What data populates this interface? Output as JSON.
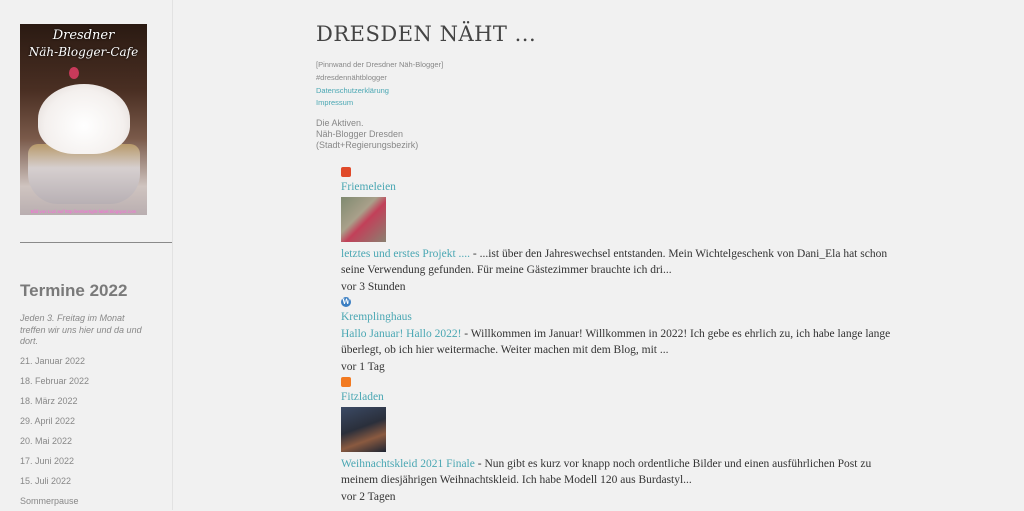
{
  "sidebar": {
    "logo": {
      "line1": "Dresdner",
      "line2": "Näh-Blogger-Cafe",
      "credit": "Bild von Luzi auf http://embertight-label.blogspot.com"
    },
    "termine_title": "Termine 2022",
    "termine_description": "Jeden 3. Freitag im Monat treffen wir uns hier und da und dort.",
    "dates": [
      "21. Januar 2022",
      "18. Februar 2022",
      "18. März 2022",
      "29. April 2022",
      "20. Mai 2022",
      "17. Juni 2022",
      "15. Juli 2022",
      "Sommerpause"
    ]
  },
  "main": {
    "site_title": "DRESDEN NÄHT ...",
    "meta": {
      "pinnwand": "[Pinnwand der Dresdner Näh-Blogger]",
      "hashtag": "#dresdennähtblogger",
      "datenschutz": "Datenschutzerklärung",
      "impressum": "Impressum"
    },
    "aktive": {
      "line1": "Die Aktiven.",
      "line2": "Näh-Blogger Dresden",
      "line3": "(Stadt+Regierungsbezirk)"
    },
    "feed": [
      {
        "icon": "favicon-red-icon",
        "blog": "Friemeleien",
        "title": "letztes und erstes Projekt ....",
        "excerpt": " - ...ist über den Jahreswechsel entstanden. Mein Wichtelgeschenk von Dani_Ela hat schon seine Verwendung gefunden. Für meine Gästezimmer brauchte ich dri...",
        "time": "vor 3 Stunden"
      },
      {
        "icon": "wordpress-icon",
        "blog": "Kremplinghaus",
        "title": "Hallo Januar! Hallo 2022!",
        "excerpt": " - Willkommen im Januar! Willkommen in 2022! Ich gebe es ehrlich zu, ich habe lange lange überlegt, ob ich hier weitermache. Weiter machen mit dem Blog, mit ...",
        "time": "vor 1 Tag"
      },
      {
        "icon": "blogger-icon",
        "blog": "Fitzladen",
        "title": "Weihnachtskleid 2021 Finale",
        "excerpt": " - Nun gibt es kurz vor knapp noch ordentliche Bilder und einen ausführlichen Post zu meinem diesjährigen Weihnachtskleid. Ich habe Modell 120 aus Burdastyl...",
        "time": "vor 2 Tagen"
      }
    ]
  },
  "colors": {
    "background": "#f1f1f1",
    "link": "#4aa7b3",
    "text": "#333333",
    "muted": "#888888"
  }
}
